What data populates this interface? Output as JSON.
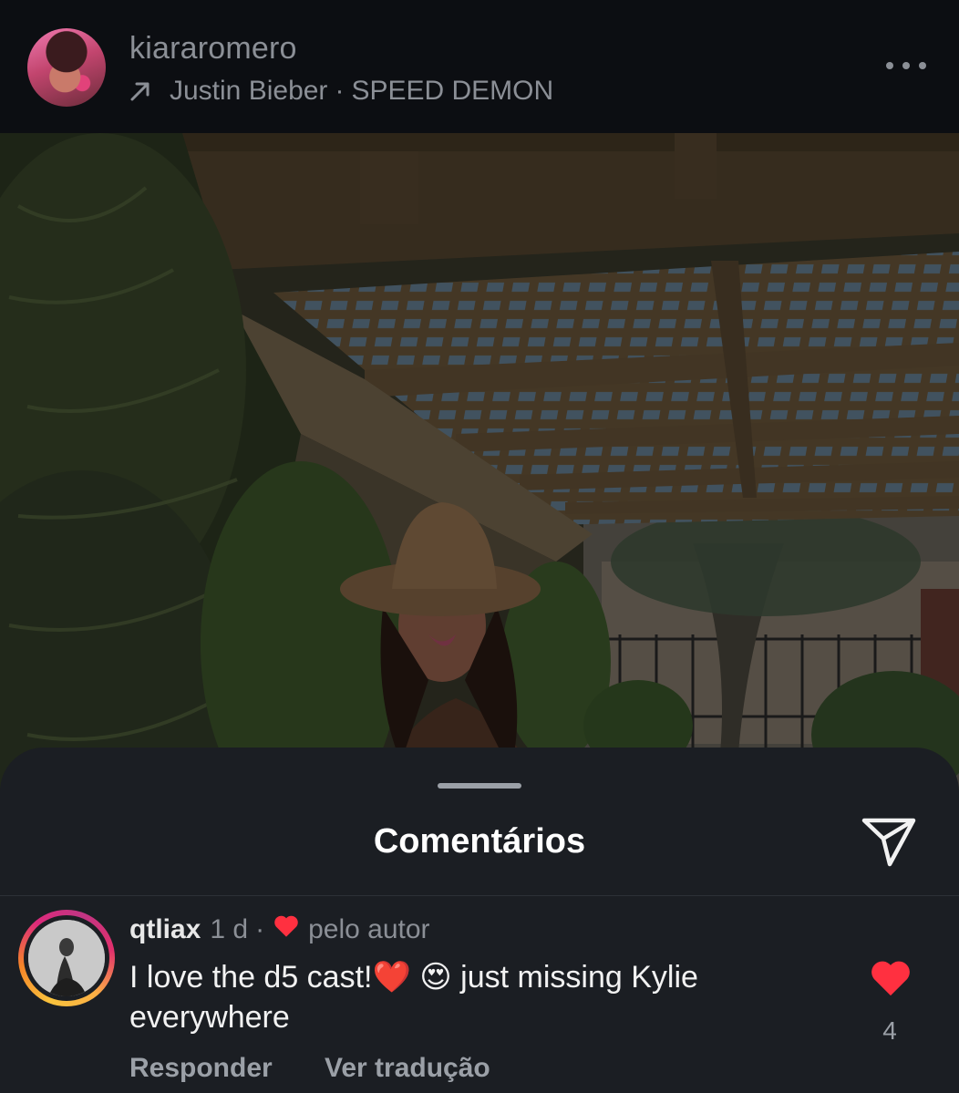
{
  "post": {
    "username": "kiararomero",
    "music_artist": "Justin Bieber",
    "music_separator": "·",
    "music_track": "SPEED DEMON"
  },
  "comments_sheet": {
    "title": "Comentários"
  },
  "comment": {
    "username": "qtliax",
    "time": "1 d",
    "separator": "·",
    "author_note": "pelo autor",
    "text": "I love the d5 cast!❤️ 😍 just missing Kylie everywhere",
    "like_count": "4",
    "reply_label": "Responder",
    "translate_label": "Ver tradução"
  },
  "colors": {
    "like_red": "#ff3040",
    "muted_text": "#8b8f96",
    "sheet_bg": "#1b1e23"
  },
  "icons": {
    "more": "more-icon",
    "music_arrow": "arrow-up-right-icon",
    "share": "paper-plane-icon",
    "like": "heart-icon"
  }
}
